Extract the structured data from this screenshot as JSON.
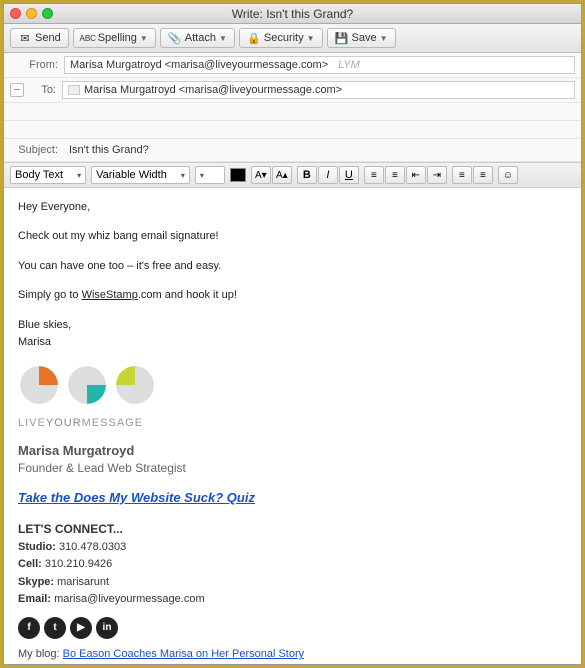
{
  "window": {
    "title": "Write: Isn't this Grand?"
  },
  "toolbar": {
    "send": "Send",
    "spelling": "Spelling",
    "attach": "Attach",
    "security": "Security",
    "save": "Save"
  },
  "headers": {
    "from_label": "From:",
    "from_value": "Marisa Murgatroyd <marisa@liveyourmessage.com>",
    "from_suffix": "LYM",
    "to_label": "To:",
    "to_value": "Marisa Murgatroyd <marisa@liveyourmessage.com>",
    "subject_label": "Subject:",
    "subject_value": "Isn't this Grand?"
  },
  "format": {
    "style": "Body Text",
    "font": "Variable Width"
  },
  "body": {
    "p1": "Hey Everyone,",
    "p2": "Check out my whiz bang email signature!",
    "p3": "You can have one too – it's free and easy.",
    "p4a": "Simply go to ",
    "p4link": "WiseStamp",
    "p4b": ".com and hook it up!",
    "p5": "Blue skies,",
    "p6": "Marisa"
  },
  "signature": {
    "brand1": "LIVE",
    "brand2": "YOUR",
    "brand3": "MESSAGE",
    "name": "Marisa Murgatroyd",
    "title": "Founder & Lead Web Strategist",
    "quiz": "Take the Does My Website Suck? Quiz",
    "connect": "LET'S CONNECT...",
    "studio_l": "Studio:",
    "studio_v": " 310.478.0303",
    "cell_l": "Cell:",
    "cell_v": " 310.210.9426",
    "skype_l": "Skype:",
    "skype_v": " marisarunt",
    "email_l": "Email:",
    "email_v": " marisa@liveyourmessage.com",
    "blog_l": "My blog: ",
    "blog_link": "Bo Eason Coaches Marisa on Her Personal Story"
  },
  "social": {
    "fb": "f",
    "tw": "t",
    "yt": "▶",
    "in": "in"
  }
}
